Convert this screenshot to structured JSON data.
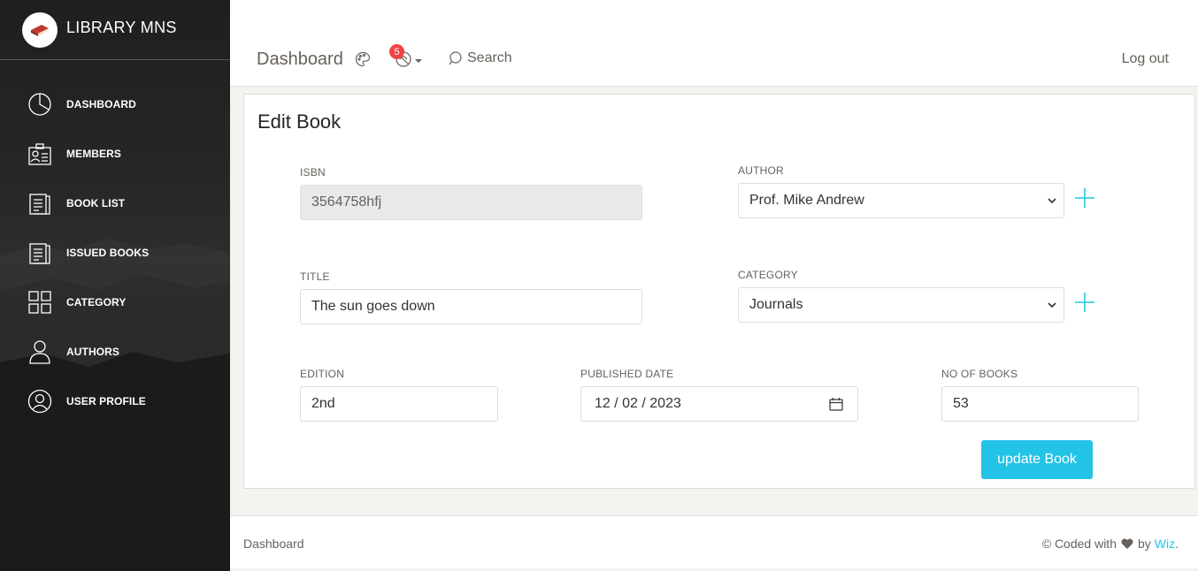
{
  "sidebar": {
    "app_title": "LIBRARY MNS",
    "items": [
      {
        "label": "DASHBOARD",
        "icon": "pie-chart-icon"
      },
      {
        "label": "MEMBERS",
        "icon": "id-badge-icon"
      },
      {
        "label": "BOOK LIST",
        "icon": "document-icon"
      },
      {
        "label": "ISSUED BOOKS",
        "icon": "document-icon"
      },
      {
        "label": "CATEGORY",
        "icon": "grid-icon"
      },
      {
        "label": "AUTHORS",
        "icon": "user-icon"
      },
      {
        "label": "USER PROFILE",
        "icon": "user-circle-icon"
      }
    ]
  },
  "topbar": {
    "title": "Dashboard",
    "notification_count": "5",
    "search_label": "Search",
    "logout_label": "Log out"
  },
  "form": {
    "heading": "Edit Book",
    "isbn": {
      "label": "ISBN",
      "value": "3564758hfj"
    },
    "author": {
      "label": "AUTHOR",
      "value": "Prof. Mike Andrew"
    },
    "title": {
      "label": "TITLE",
      "value": "The sun goes down"
    },
    "category": {
      "label": "CATEGORY",
      "value": "Journals"
    },
    "edition": {
      "label": "EDITION",
      "value": "2nd"
    },
    "published": {
      "label": "PUBLISHED DATE",
      "value": "12 / 02 / 2023"
    },
    "copies": {
      "label": "NO OF BOOKS",
      "value": "53"
    },
    "submit_label": "update Book"
  },
  "footer": {
    "left": "Dashboard",
    "prefix": "© Coded with",
    "by": "by",
    "author": "Wiz",
    "suffix": "."
  },
  "colors": {
    "accent": "#22c3e6",
    "badge": "#ef4444",
    "sidebar_bg": "#1f1f1f"
  }
}
